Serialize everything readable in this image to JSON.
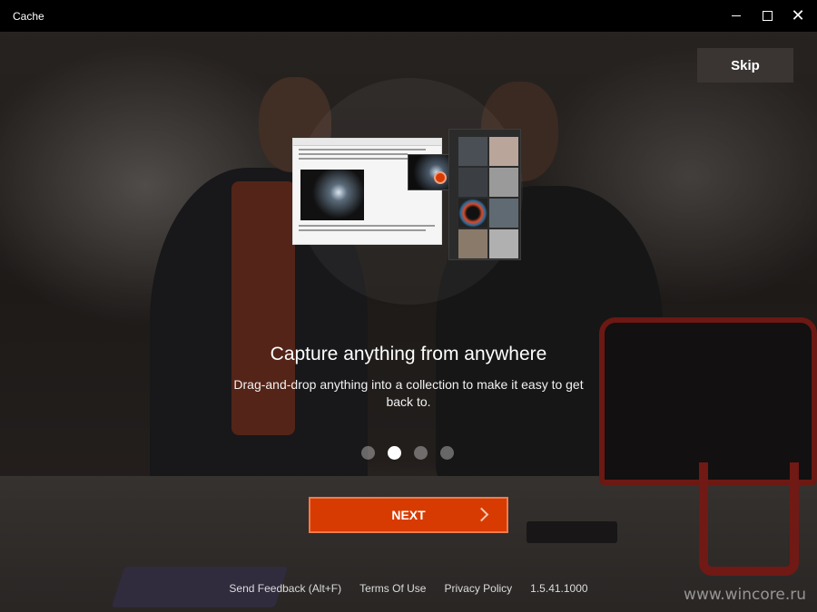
{
  "window": {
    "title": "Cache",
    "controls": {
      "minimize": "",
      "maximize": "",
      "close": "✕"
    }
  },
  "onboarding": {
    "skip_label": "Skip",
    "heading": "Capture anything from anywhere",
    "description": "Drag-and-drop anything into a collection to make it easy to get back to.",
    "page_count": 4,
    "current_page": 2,
    "next_label": "NEXT"
  },
  "footer": {
    "feedback": "Send Feedback (Alt+F)",
    "terms": "Terms Of Use",
    "privacy": "Privacy Policy",
    "version": "1.5.41.1000"
  },
  "watermark": "www.wincore.ru",
  "colors": {
    "accent": "#d83b01",
    "titlebar": "#000000",
    "skip_button": "#3a3533"
  }
}
